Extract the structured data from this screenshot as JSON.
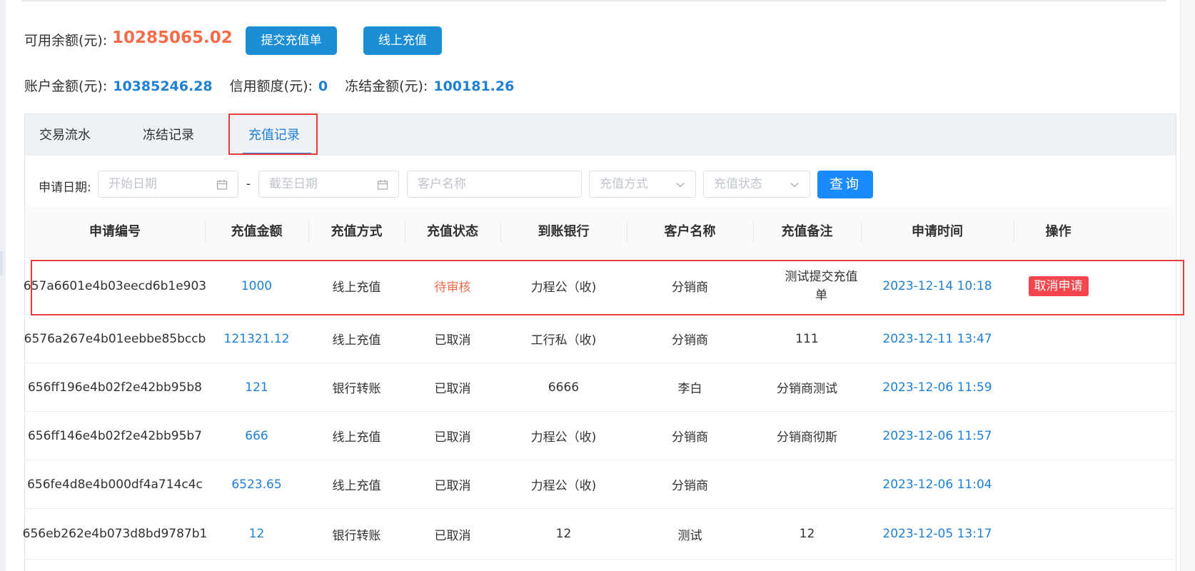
{
  "balance": {
    "available_label": "可用余额(元):",
    "available_value": "10285065.02",
    "submit_button": "提交充值单",
    "online_button": "线上充值"
  },
  "account": {
    "total_label": "账户金额(元):",
    "total_value": "10385246.28",
    "credit_label": "信用额度(元):",
    "credit_value": "0",
    "frozen_label": "冻结金额(元):",
    "frozen_value": "100181.26"
  },
  "tabs": [
    {
      "label": "交易流水"
    },
    {
      "label": "冻结记录"
    },
    {
      "label": "充值记录"
    }
  ],
  "filters": {
    "date_label": "申请日期:",
    "start_placeholder": "开始日期",
    "separator": "-",
    "end_placeholder": "截至日期",
    "customer_placeholder": "客户名称",
    "method_placeholder": "充值方式",
    "status_placeholder": "充值状态",
    "query_button": "查询"
  },
  "icons": {
    "calendar": "calendar-icon",
    "chevron": "chevron-down-icon"
  },
  "colors": {
    "accent": "#1e7fd6",
    "primary_button": "#1a8aff",
    "amount_highlight": "#f56c4a",
    "danger": "#f5454d"
  },
  "table": {
    "columns": [
      "申请编号",
      "充值金额",
      "充值方式",
      "充值状态",
      "到账银行",
      "客户名称",
      "充值备注",
      "申请时间",
      "操作"
    ],
    "rows": [
      {
        "id": "657a6601e4b03eecd6b1e903",
        "amount": "1000",
        "method": "线上充值",
        "status": "待审核",
        "bank": "力程公（收)",
        "customer": "分销商",
        "note": "测试提交充值单",
        "time": "2023-12-14 10:18",
        "action": "取消申请"
      },
      {
        "id": "6576a267e4b01eebbe85bccb",
        "amount": "121321.12",
        "method": "线上充值",
        "status": "已取消",
        "bank": "工行私（收)",
        "customer": "分销商",
        "note": "111",
        "time": "2023-12-11 13:47",
        "action": ""
      },
      {
        "id": "656ff196e4b02f2e42bb95b8",
        "amount": "121",
        "method": "银行转账",
        "status": "已取消",
        "bank": "6666",
        "customer": "李白",
        "note": "分销商测试",
        "time": "2023-12-06 11:59",
        "action": ""
      },
      {
        "id": "656ff146e4b02f2e42bb95b7",
        "amount": "666",
        "method": "线上充值",
        "status": "已取消",
        "bank": "力程公（收)",
        "customer": "分销商",
        "note": "分销商彻斯",
        "time": "2023-12-06 11:57",
        "action": ""
      },
      {
        "id": "656fe4d8e4b000df4a714c4c",
        "amount": "6523.65",
        "method": "线上充值",
        "status": "已取消",
        "bank": "力程公（收)",
        "customer": "分销商",
        "note": "",
        "time": "2023-12-06 11:04",
        "action": ""
      },
      {
        "id": "656eb262e4b073d8bd9787b1",
        "amount": "12",
        "method": "银行转账",
        "status": "已取消",
        "bank": "12",
        "customer": "测试",
        "note": "12",
        "time": "2023-12-05 13:17",
        "action": ""
      }
    ]
  }
}
